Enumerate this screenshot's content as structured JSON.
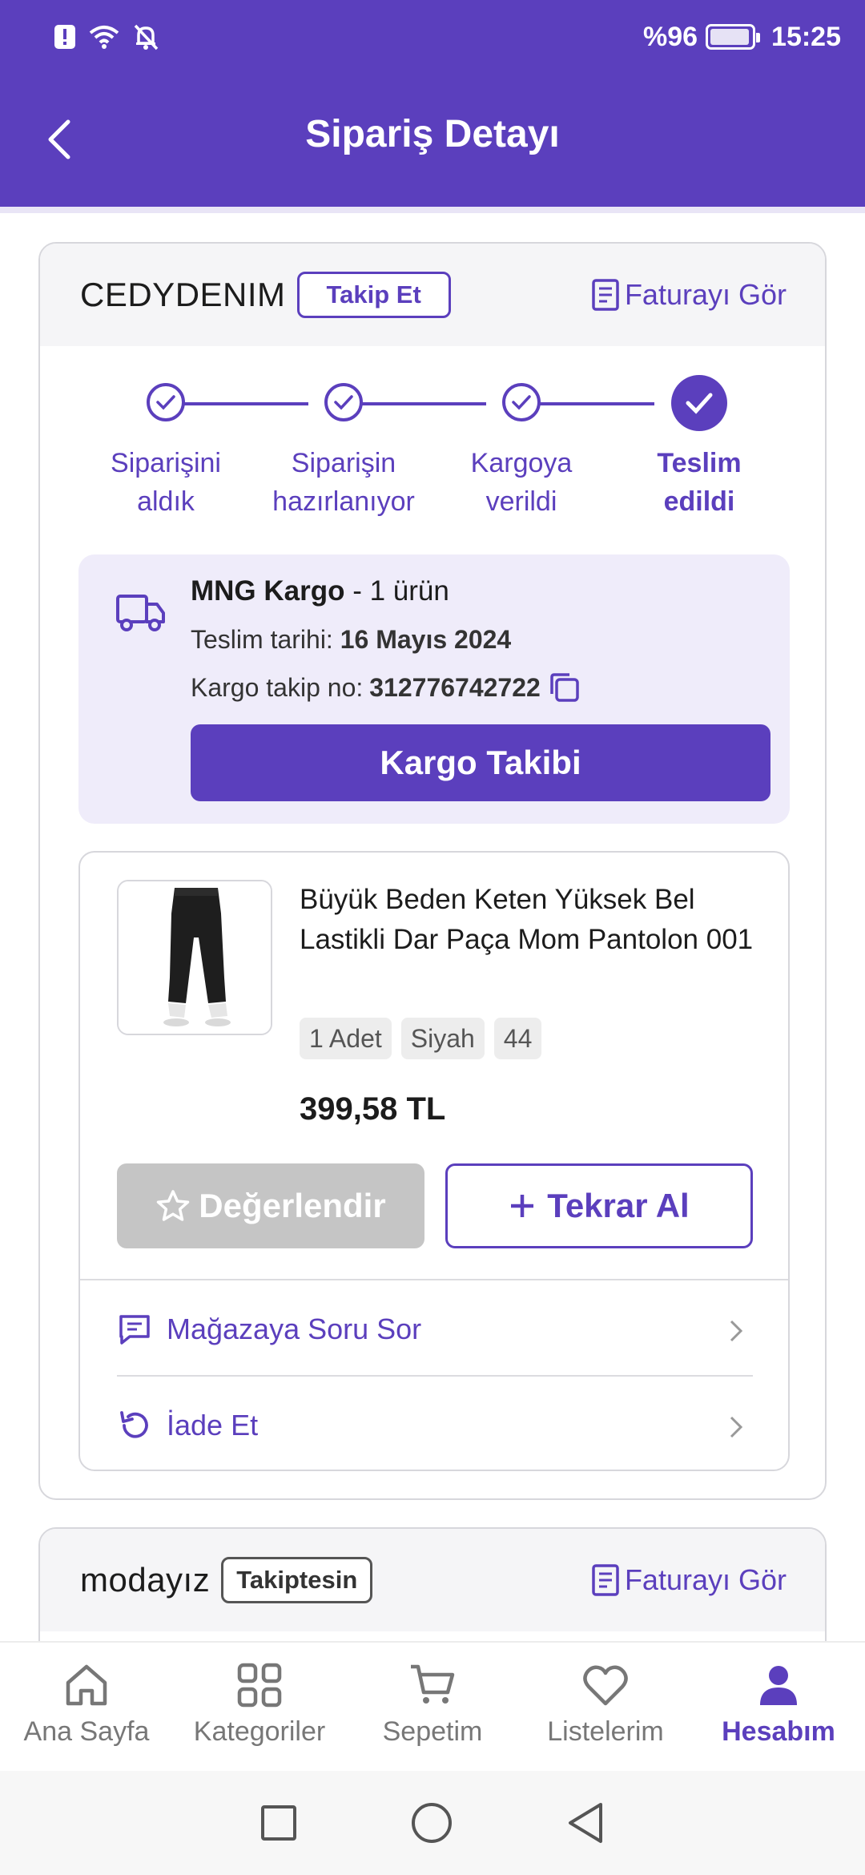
{
  "status_bar": {
    "battery": "%96",
    "time": "15:25"
  },
  "app_bar": {
    "title": "Sipariş Detayı"
  },
  "order1": {
    "store": "CEDYDENIM",
    "follow_label": "Takip Et",
    "invoice_label": "Faturayı Gör",
    "steps": [
      {
        "line1": "Siparişini",
        "line2": "aldık"
      },
      {
        "line1": "Siparişin",
        "line2": "hazırlanıyor"
      },
      {
        "line1": "Kargoya",
        "line2": "verildi"
      },
      {
        "line1": "Teslim",
        "line2": "edildi"
      }
    ],
    "shipment": {
      "carrier": "MNG Kargo",
      "count": "- 1 ürün",
      "delivery_label": "Teslim tarihi:",
      "delivery_date": "16 Mayıs 2024",
      "tracking_label": "Kargo takip no:",
      "tracking_no": "312776742722",
      "track_button": "Kargo Takibi"
    },
    "product": {
      "name": "Büyük Beden Keten Yüksek Bel Lastikli Dar Paça Mom Pantolon 001",
      "tags": [
        "1 Adet",
        "Siyah",
        "44"
      ],
      "price": "399,58 TL",
      "rate_label": "Değerlendir",
      "rebuy_label": "Tekrar Al",
      "ask_label": "Mağazaya Soru Sor",
      "return_label": "İade Et"
    }
  },
  "order2": {
    "store": "modayız",
    "following_label": "Takiptesin",
    "invoice_label": "Faturayı Gör"
  },
  "bottom_nav": {
    "items": [
      {
        "label": "Ana Sayfa",
        "icon": "home-icon"
      },
      {
        "label": "Kategoriler",
        "icon": "grid-icon"
      },
      {
        "label": "Sepetim",
        "icon": "cart-icon"
      },
      {
        "label": "Listelerim",
        "icon": "heart-icon"
      },
      {
        "label": "Hesabım",
        "icon": "user-icon"
      }
    ],
    "active": "Hesabım"
  },
  "colors": {
    "primary": "#5b3fbd",
    "tint": "#efecfa",
    "disabled": "#c5c5c5"
  }
}
